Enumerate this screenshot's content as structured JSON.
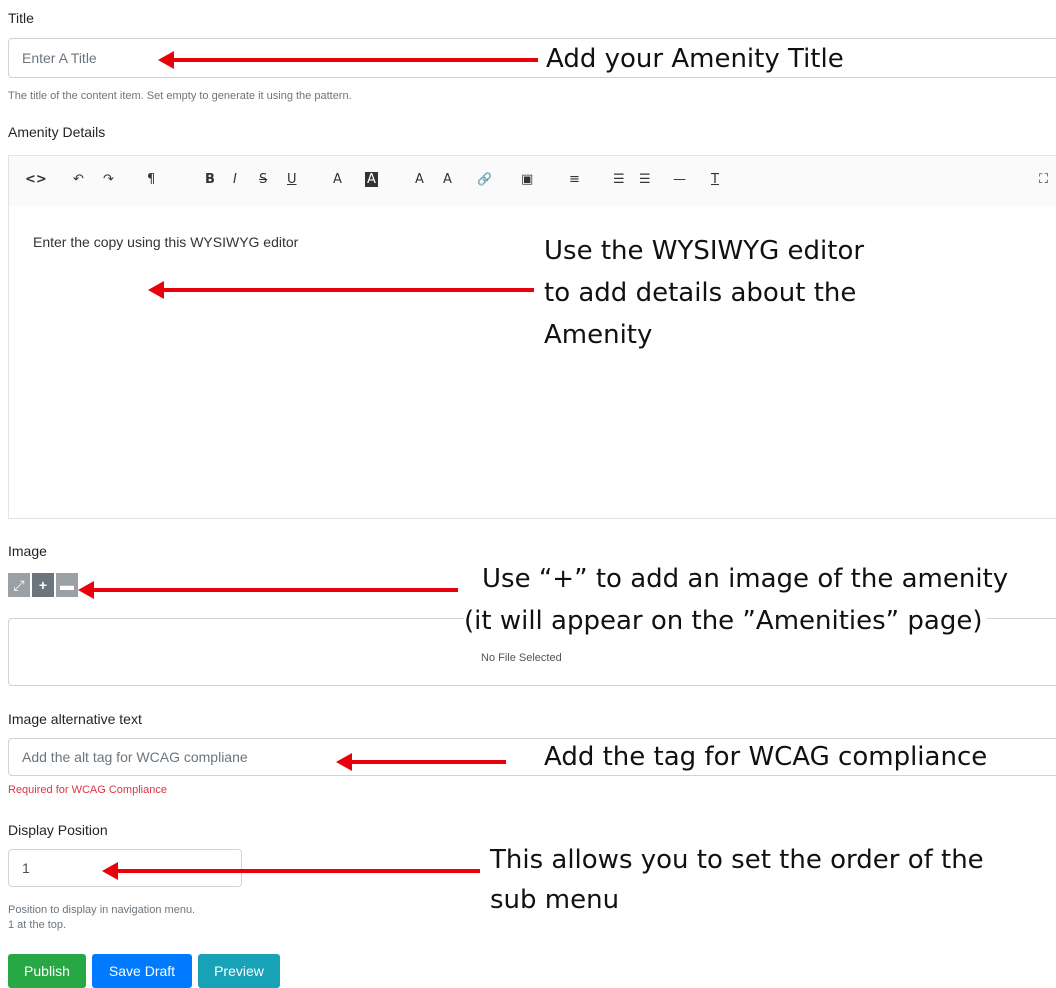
{
  "fields": {
    "title": {
      "label": "Title",
      "placeholder": "Enter A Title",
      "help": "The title of the content item. Set empty to generate it using the pattern."
    },
    "details": {
      "label": "Amenity Details",
      "placeholder": "Enter the copy using this WYSIWYG editor"
    },
    "image": {
      "label": "Image",
      "no_file": "No File Selected"
    },
    "alt_text": {
      "label": "Image alternative text",
      "placeholder": "Add the alt tag for WCAG compliane",
      "required": "Required for WCAG Compliance"
    },
    "position": {
      "label": "Display Position",
      "value": "1",
      "help_line1": "Position to display in navigation menu.",
      "help_line2": "1 at the top."
    }
  },
  "toolbar": {
    "icons": [
      "code-view-icon",
      "undo-icon",
      "redo-icon",
      "paragraph-icon",
      "bold-icon",
      "italic-icon",
      "strikethrough-icon",
      "underline-icon",
      "font-color-icon",
      "background-color-icon",
      "superscript-icon",
      "subscript-icon",
      "link-icon",
      "image-icon",
      "align-icon",
      "bulleted-list-icon",
      "numbered-list-icon",
      "horizontal-rule-icon",
      "clear-formatting-icon",
      "fullscreen-icon"
    ],
    "glyphs": [
      "<>",
      "↶",
      "↷",
      "¶",
      "B",
      "I",
      "S",
      "U",
      "A",
      "A",
      "A",
      "A",
      "🔗",
      "▣",
      "≡",
      "☰",
      "☰",
      "—",
      "T",
      "⛶"
    ]
  },
  "buttons": {
    "publish": "Publish",
    "save_draft": "Save Draft",
    "preview": "Preview"
  },
  "annotations": {
    "title": "Add your Amenity Title",
    "details_1": "Use the WYSIWYG editor",
    "details_2": "to add details about the",
    "details_3": "Amenity",
    "image_1": "Use “+” to add an image of the amenity",
    "image_2": "(it will appear on the ”Amenities” page)",
    "alt": "Add the tag for WCAG compliance",
    "position_1": "This allows you to set the order of the",
    "position_2": "sub menu"
  },
  "colors": {
    "publish": "#28a745",
    "save_draft": "#007bff",
    "preview": "#17a2b8",
    "arrow": "#e8000b"
  }
}
